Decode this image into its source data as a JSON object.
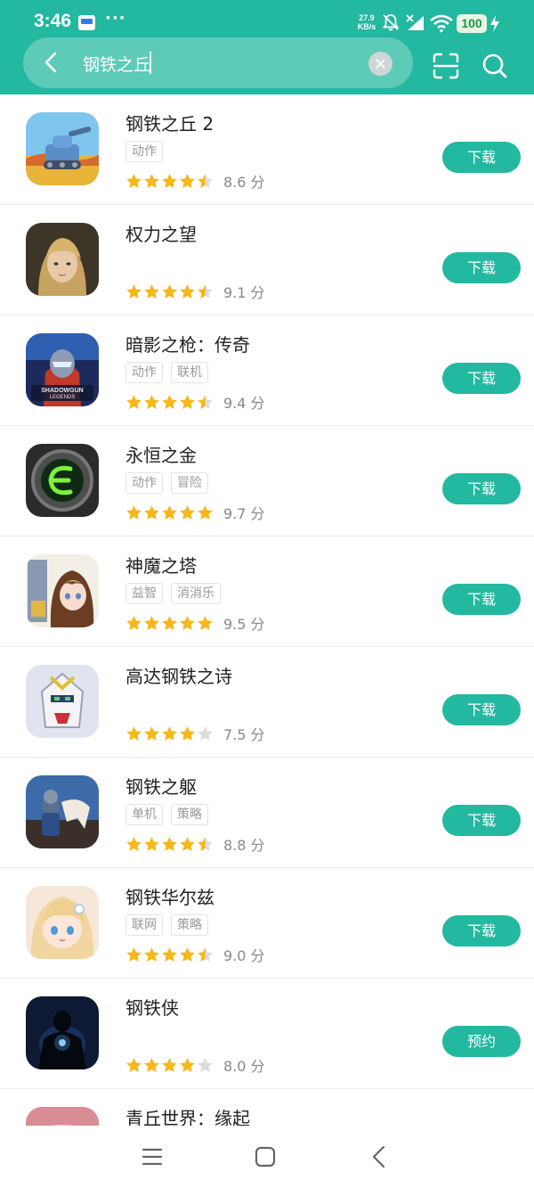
{
  "status_bar": {
    "time": "3:46",
    "more": "···",
    "net_speed_value": "27.9",
    "net_speed_unit": "KB/s",
    "battery": "100"
  },
  "search": {
    "query": "钢铁之丘",
    "clear_icon": "close-icon",
    "back_icon": "back-arrow-icon",
    "scan_icon": "scan-icon",
    "search_icon": "search-icon"
  },
  "colors": {
    "accent": "#23b8a0",
    "star": "#f6b818",
    "star_empty": "#dcdcdc"
  },
  "apps": [
    {
      "name": "钢铁之丘 2",
      "tags": [
        "动作"
      ],
      "stars": 4.5,
      "score": "8.6 分",
      "action": "下载"
    },
    {
      "name": "权力之望",
      "tags": [],
      "stars": 4.5,
      "score": "9.1 分",
      "action": "下载"
    },
    {
      "name": "暗影之枪：传奇",
      "tags": [
        "动作",
        "联机"
      ],
      "stars": 4.5,
      "score": "9.4 分",
      "action": "下载"
    },
    {
      "name": "永恒之金",
      "tags": [
        "动作",
        "冒险"
      ],
      "stars": 5,
      "score": "9.7 分",
      "action": "下载"
    },
    {
      "name": "神魔之塔",
      "tags": [
        "益智",
        "消消乐"
      ],
      "stars": 5,
      "score": "9.5 分",
      "action": "下载"
    },
    {
      "name": "高达钢铁之诗",
      "tags": [],
      "stars": 4,
      "score": "7.5 分",
      "action": "下载"
    },
    {
      "name": "钢铁之躯",
      "tags": [
        "单机",
        "策略"
      ],
      "stars": 4.5,
      "score": "8.8 分",
      "action": "下载"
    },
    {
      "name": "钢铁华尔兹",
      "tags": [
        "联网",
        "策略"
      ],
      "stars": 4.5,
      "score": "9.0 分",
      "action": "下载"
    },
    {
      "name": "钢铁侠",
      "tags": [],
      "stars": 4,
      "score": "8.0 分",
      "action": "预约"
    },
    {
      "name": "青丘世界：缘起",
      "tags": [],
      "stars": 0,
      "score": "",
      "action": ""
    }
  ],
  "nav": {
    "menu_icon": "menu-icon",
    "home_icon": "home-icon",
    "back_icon": "nav-back-icon"
  }
}
